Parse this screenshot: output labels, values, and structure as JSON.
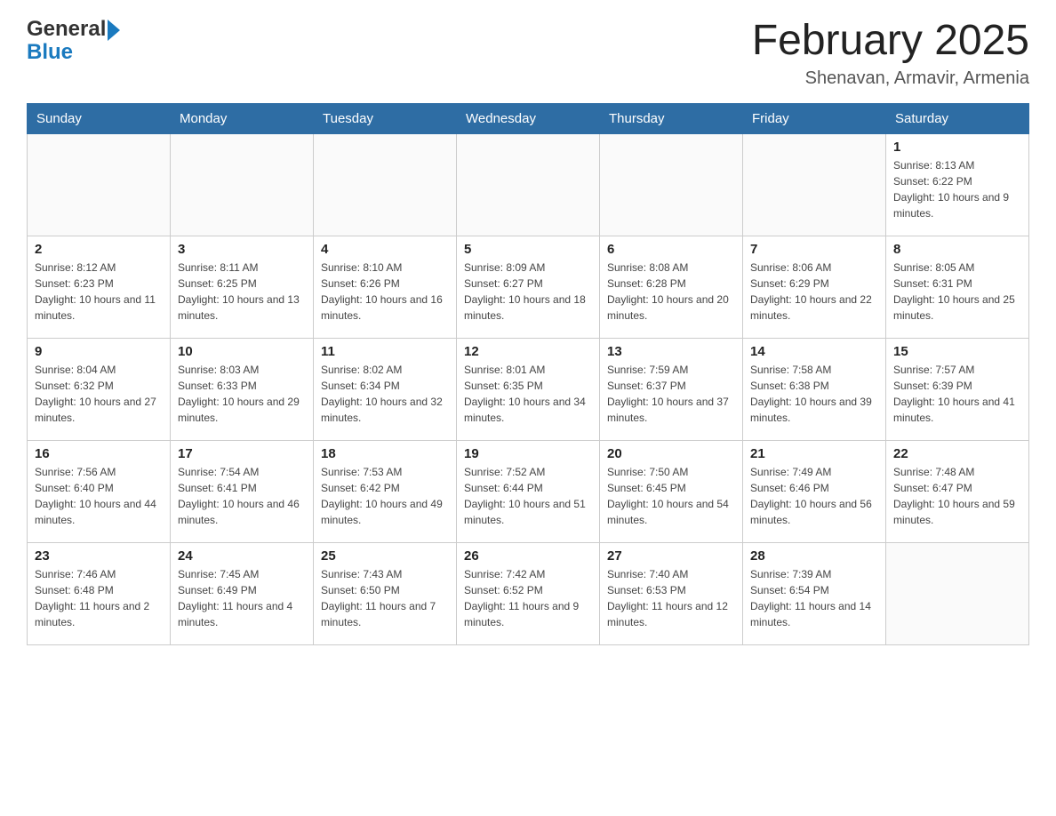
{
  "header": {
    "logo_line1": "General",
    "logo_line2": "Blue",
    "month_title": "February 2025",
    "location": "Shenavan, Armavir, Armenia"
  },
  "days_of_week": [
    "Sunday",
    "Monday",
    "Tuesday",
    "Wednesday",
    "Thursday",
    "Friday",
    "Saturday"
  ],
  "weeks": [
    [
      {
        "day": "",
        "info": ""
      },
      {
        "day": "",
        "info": ""
      },
      {
        "day": "",
        "info": ""
      },
      {
        "day": "",
        "info": ""
      },
      {
        "day": "",
        "info": ""
      },
      {
        "day": "",
        "info": ""
      },
      {
        "day": "1",
        "info": "Sunrise: 8:13 AM\nSunset: 6:22 PM\nDaylight: 10 hours and 9 minutes."
      }
    ],
    [
      {
        "day": "2",
        "info": "Sunrise: 8:12 AM\nSunset: 6:23 PM\nDaylight: 10 hours and 11 minutes."
      },
      {
        "day": "3",
        "info": "Sunrise: 8:11 AM\nSunset: 6:25 PM\nDaylight: 10 hours and 13 minutes."
      },
      {
        "day": "4",
        "info": "Sunrise: 8:10 AM\nSunset: 6:26 PM\nDaylight: 10 hours and 16 minutes."
      },
      {
        "day": "5",
        "info": "Sunrise: 8:09 AM\nSunset: 6:27 PM\nDaylight: 10 hours and 18 minutes."
      },
      {
        "day": "6",
        "info": "Sunrise: 8:08 AM\nSunset: 6:28 PM\nDaylight: 10 hours and 20 minutes."
      },
      {
        "day": "7",
        "info": "Sunrise: 8:06 AM\nSunset: 6:29 PM\nDaylight: 10 hours and 22 minutes."
      },
      {
        "day": "8",
        "info": "Sunrise: 8:05 AM\nSunset: 6:31 PM\nDaylight: 10 hours and 25 minutes."
      }
    ],
    [
      {
        "day": "9",
        "info": "Sunrise: 8:04 AM\nSunset: 6:32 PM\nDaylight: 10 hours and 27 minutes."
      },
      {
        "day": "10",
        "info": "Sunrise: 8:03 AM\nSunset: 6:33 PM\nDaylight: 10 hours and 29 minutes."
      },
      {
        "day": "11",
        "info": "Sunrise: 8:02 AM\nSunset: 6:34 PM\nDaylight: 10 hours and 32 minutes."
      },
      {
        "day": "12",
        "info": "Sunrise: 8:01 AM\nSunset: 6:35 PM\nDaylight: 10 hours and 34 minutes."
      },
      {
        "day": "13",
        "info": "Sunrise: 7:59 AM\nSunset: 6:37 PM\nDaylight: 10 hours and 37 minutes."
      },
      {
        "day": "14",
        "info": "Sunrise: 7:58 AM\nSunset: 6:38 PM\nDaylight: 10 hours and 39 minutes."
      },
      {
        "day": "15",
        "info": "Sunrise: 7:57 AM\nSunset: 6:39 PM\nDaylight: 10 hours and 41 minutes."
      }
    ],
    [
      {
        "day": "16",
        "info": "Sunrise: 7:56 AM\nSunset: 6:40 PM\nDaylight: 10 hours and 44 minutes."
      },
      {
        "day": "17",
        "info": "Sunrise: 7:54 AM\nSunset: 6:41 PM\nDaylight: 10 hours and 46 minutes."
      },
      {
        "day": "18",
        "info": "Sunrise: 7:53 AM\nSunset: 6:42 PM\nDaylight: 10 hours and 49 minutes."
      },
      {
        "day": "19",
        "info": "Sunrise: 7:52 AM\nSunset: 6:44 PM\nDaylight: 10 hours and 51 minutes."
      },
      {
        "day": "20",
        "info": "Sunrise: 7:50 AM\nSunset: 6:45 PM\nDaylight: 10 hours and 54 minutes."
      },
      {
        "day": "21",
        "info": "Sunrise: 7:49 AM\nSunset: 6:46 PM\nDaylight: 10 hours and 56 minutes."
      },
      {
        "day": "22",
        "info": "Sunrise: 7:48 AM\nSunset: 6:47 PM\nDaylight: 10 hours and 59 minutes."
      }
    ],
    [
      {
        "day": "23",
        "info": "Sunrise: 7:46 AM\nSunset: 6:48 PM\nDaylight: 11 hours and 2 minutes."
      },
      {
        "day": "24",
        "info": "Sunrise: 7:45 AM\nSunset: 6:49 PM\nDaylight: 11 hours and 4 minutes."
      },
      {
        "day": "25",
        "info": "Sunrise: 7:43 AM\nSunset: 6:50 PM\nDaylight: 11 hours and 7 minutes."
      },
      {
        "day": "26",
        "info": "Sunrise: 7:42 AM\nSunset: 6:52 PM\nDaylight: 11 hours and 9 minutes."
      },
      {
        "day": "27",
        "info": "Sunrise: 7:40 AM\nSunset: 6:53 PM\nDaylight: 11 hours and 12 minutes."
      },
      {
        "day": "28",
        "info": "Sunrise: 7:39 AM\nSunset: 6:54 PM\nDaylight: 11 hours and 14 minutes."
      },
      {
        "day": "",
        "info": ""
      }
    ]
  ]
}
